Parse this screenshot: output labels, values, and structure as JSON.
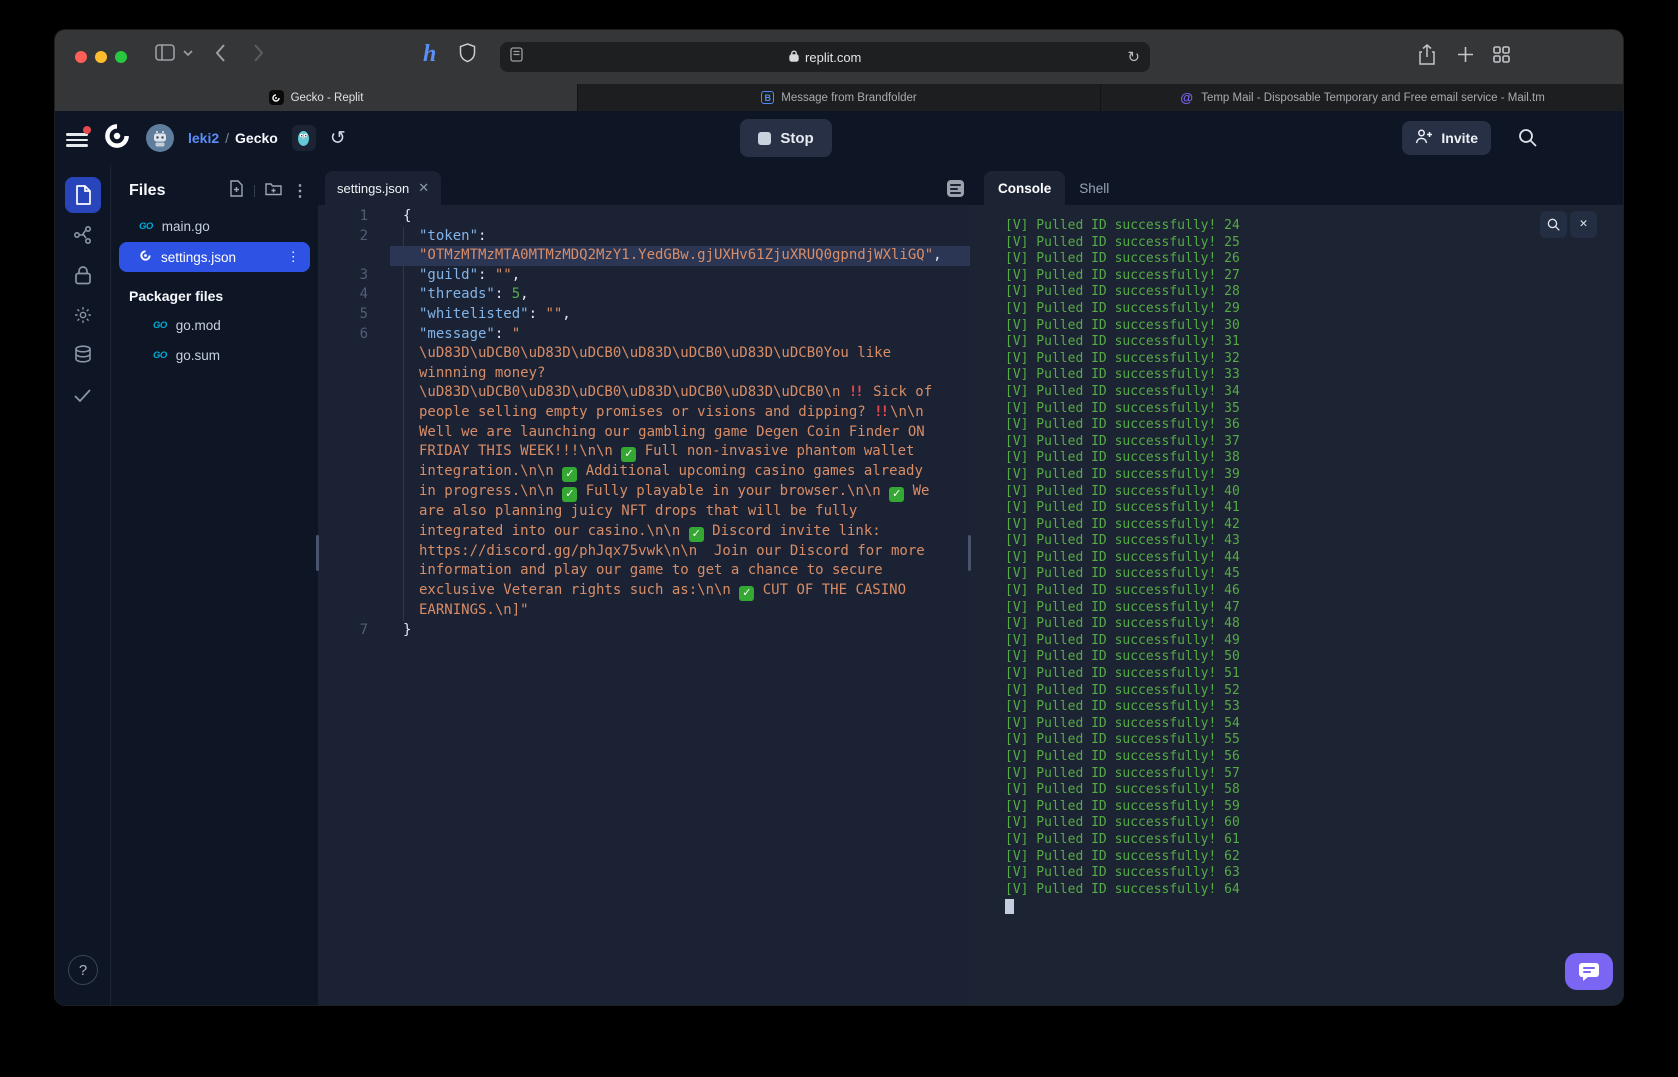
{
  "colors": {
    "accent_blue": "#2e53e4",
    "console_green": "#55ab45",
    "chat_purple": "#7a66f3",
    "stop_surface": "#273044"
  },
  "browser": {
    "url": "replit.com",
    "tabs": [
      {
        "title": "Gecko - Replit",
        "icon": "replit-favicon",
        "active": true
      },
      {
        "title": "Message from Brandfolder",
        "icon": "brandfolder-favicon",
        "active": false
      },
      {
        "title": "Temp Mail - Disposable Temporary and Free email service - Mail.tm",
        "icon": "mailtm-favicon",
        "active": false
      }
    ]
  },
  "header": {
    "username": "leki2",
    "separator": "/",
    "project": "Gecko",
    "stop_label": "Stop",
    "invite_label": "Invite"
  },
  "files_panel": {
    "title": "Files",
    "items": [
      {
        "name": "main.go",
        "icon": "go",
        "selected": false
      },
      {
        "name": "settings.json",
        "icon": "replit",
        "selected": true
      }
    ],
    "section": "Packager files",
    "packager_items": [
      {
        "name": "go.mod",
        "icon": "go"
      },
      {
        "name": "go.sum",
        "icon": "go"
      }
    ]
  },
  "editor": {
    "tab": "settings.json",
    "lines": [
      {
        "n": "1",
        "ind": 0,
        "g": false,
        "hl": false,
        "segs": [
          [
            "punc",
            "{"
          ]
        ]
      },
      {
        "n": "2",
        "ind": 1,
        "g": true,
        "hl": false,
        "segs": [
          [
            "key",
            "\"token\""
          ],
          [
            "punc",
            ":"
          ]
        ]
      },
      {
        "n": "",
        "ind": 1,
        "g": true,
        "hl": true,
        "segs": [
          [
            "str",
            "\"OTMzMTMzMTA0MTMzMDQ2MzY1.YedGBw.gjUXHv61ZjuXRUQ0gpndjWXliGQ\""
          ],
          [
            "punc",
            ","
          ]
        ]
      },
      {
        "n": "3",
        "ind": 1,
        "g": true,
        "hl": false,
        "segs": [
          [
            "key",
            "\"guild\""
          ],
          [
            "punc",
            ": "
          ],
          [
            "str",
            "\"\""
          ],
          [
            "punc",
            ","
          ]
        ]
      },
      {
        "n": "4",
        "ind": 1,
        "g": true,
        "hl": false,
        "segs": [
          [
            "key",
            "\"threads\""
          ],
          [
            "punc",
            ": "
          ],
          [
            "num",
            "5"
          ],
          [
            "punc",
            ","
          ]
        ]
      },
      {
        "n": "5",
        "ind": 1,
        "g": true,
        "hl": false,
        "segs": [
          [
            "key",
            "\"whitelisted\""
          ],
          [
            "punc",
            ": "
          ],
          [
            "str",
            "\"\""
          ],
          [
            "punc",
            ","
          ]
        ]
      },
      {
        "n": "6",
        "ind": 1,
        "g": true,
        "hl": false,
        "segs": [
          [
            "key",
            "\"message\""
          ],
          [
            "punc",
            ": "
          ],
          [
            "str",
            "\""
          ]
        ]
      },
      {
        "n": "",
        "ind": 1,
        "g": true,
        "hl": false,
        "segs": [
          [
            "str",
            "\\uD83D\\uDCB0\\uD83D\\uDCB0\\uD83D\\uDCB0\\uD83D\\uDCB0You like"
          ]
        ]
      },
      {
        "n": "",
        "ind": 1,
        "g": true,
        "hl": false,
        "segs": [
          [
            "str",
            "winnning money?"
          ]
        ]
      },
      {
        "n": "",
        "ind": 1,
        "g": true,
        "hl": false,
        "segs": [
          [
            "str",
            "\\uD83D\\uDCB0\\uD83D\\uDCB0\\uD83D\\uDCB0\\uD83D\\uDCB0\\n "
          ],
          [
            "excl",
            "‼️"
          ],
          [
            "str",
            " Sick of"
          ]
        ]
      },
      {
        "n": "",
        "ind": 1,
        "g": true,
        "hl": false,
        "segs": [
          [
            "str",
            "people selling empty promises or visions and dipping? "
          ],
          [
            "excl",
            "‼️"
          ],
          [
            "str",
            "\\n\\n"
          ]
        ]
      },
      {
        "n": "",
        "ind": 1,
        "g": true,
        "hl": false,
        "segs": [
          [
            "str",
            "Well we are launching our gambling game Degen Coin Finder ON"
          ]
        ]
      },
      {
        "n": "",
        "ind": 1,
        "g": true,
        "hl": false,
        "segs": [
          [
            "str",
            "FRIDAY THIS WEEK!!!\\n\\n "
          ],
          [
            "check",
            "✅"
          ],
          [
            "str",
            " Full non-invasive phantom wallet"
          ]
        ]
      },
      {
        "n": "",
        "ind": 1,
        "g": true,
        "hl": false,
        "segs": [
          [
            "str",
            "integration.\\n\\n "
          ],
          [
            "check",
            "✅"
          ],
          [
            "str",
            " Additional upcoming casino games already"
          ]
        ]
      },
      {
        "n": "",
        "ind": 1,
        "g": true,
        "hl": false,
        "segs": [
          [
            "str",
            "in progress.\\n\\n "
          ],
          [
            "check",
            "✅"
          ],
          [
            "str",
            " Fully playable in your browser.\\n\\n "
          ],
          [
            "check",
            "✅"
          ],
          [
            "str",
            " We"
          ]
        ]
      },
      {
        "n": "",
        "ind": 1,
        "g": true,
        "hl": false,
        "segs": [
          [
            "str",
            "are also planning juicy NFT drops that will be fully"
          ]
        ]
      },
      {
        "n": "",
        "ind": 1,
        "g": true,
        "hl": false,
        "segs": [
          [
            "str",
            "integrated into our casino.\\n\\n "
          ],
          [
            "check",
            "✅"
          ],
          [
            "str",
            " Discord invite link:"
          ]
        ]
      },
      {
        "n": "",
        "ind": 1,
        "g": true,
        "hl": false,
        "segs": [
          [
            "str",
            "https://discord.gg/phJqx75vwk\\n\\n  Join our Discord for more"
          ]
        ]
      },
      {
        "n": "",
        "ind": 1,
        "g": true,
        "hl": false,
        "segs": [
          [
            "str",
            "information and play our game to get a chance to secure"
          ]
        ]
      },
      {
        "n": "",
        "ind": 1,
        "g": true,
        "hl": false,
        "segs": [
          [
            "str",
            "exclusive Veteran rights such as:\\n\\n "
          ],
          [
            "check",
            "✅"
          ],
          [
            "str",
            " CUT OF THE CASINO"
          ]
        ]
      },
      {
        "n": "",
        "ind": 1,
        "g": true,
        "hl": false,
        "segs": [
          [
            "str",
            "EARNINGS.\\n]\""
          ]
        ]
      },
      {
        "n": "7",
        "ind": 0,
        "g": false,
        "hl": false,
        "segs": [
          [
            "punc",
            "}"
          ]
        ]
      }
    ]
  },
  "console": {
    "tabs": [
      "Console",
      "Shell"
    ],
    "log_prefix": "[V]",
    "log_message": "Pulled ID successfully!",
    "log_start": 24,
    "log_end": 64
  }
}
